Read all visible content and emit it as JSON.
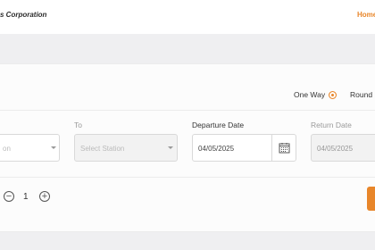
{
  "header": {
    "brand": "s Corporation",
    "nav_home": "Home"
  },
  "trip_type": {
    "options": [
      "One Way",
      "Round"
    ],
    "selected": "One Way"
  },
  "form": {
    "from": {
      "value": "on"
    },
    "to": {
      "label": "To",
      "placeholder": "Select Station"
    },
    "departure": {
      "label": "Departure Date",
      "value": "04/05/2025"
    },
    "return": {
      "label": "Return Date",
      "value": "04/05/2025"
    }
  },
  "passengers": {
    "count": "1",
    "decrement": "−",
    "increment": "+"
  },
  "colors": {
    "accent": "#e8862a",
    "background": "#efeff1"
  },
  "icons": {
    "calendar": "calendar-icon",
    "caret": "chevron-down-icon"
  }
}
